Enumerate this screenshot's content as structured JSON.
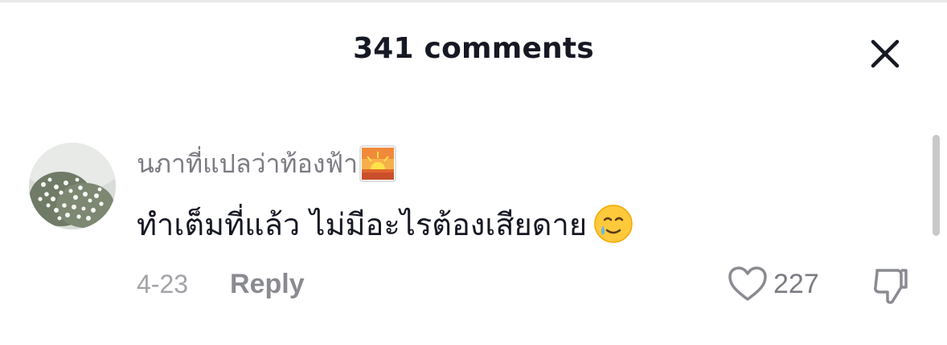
{
  "header": {
    "title": "341 comments",
    "close_icon": "close-icon"
  },
  "comment": {
    "avatar_icon": "avatar-flowers",
    "username": "นภาที่แปลว่าท้องฟ้า",
    "username_emoji": "sunrise-emoji",
    "text": "ทำเต็มที่แล้ว ไม่มีอะไรต้องเสียดาย",
    "text_emoji": "smiling-face-with-tear-emoji",
    "date": "4-23",
    "reply_label": "Reply",
    "like_icon": "heart-outline-icon",
    "like_count": "227",
    "dislike_icon": "thumbs-down-icon"
  },
  "colors": {
    "primary_text": "#161823",
    "secondary_text": "#7b7c83",
    "muted_text": "#a2a3a8",
    "scrollbar": "#c9c9cb"
  }
}
